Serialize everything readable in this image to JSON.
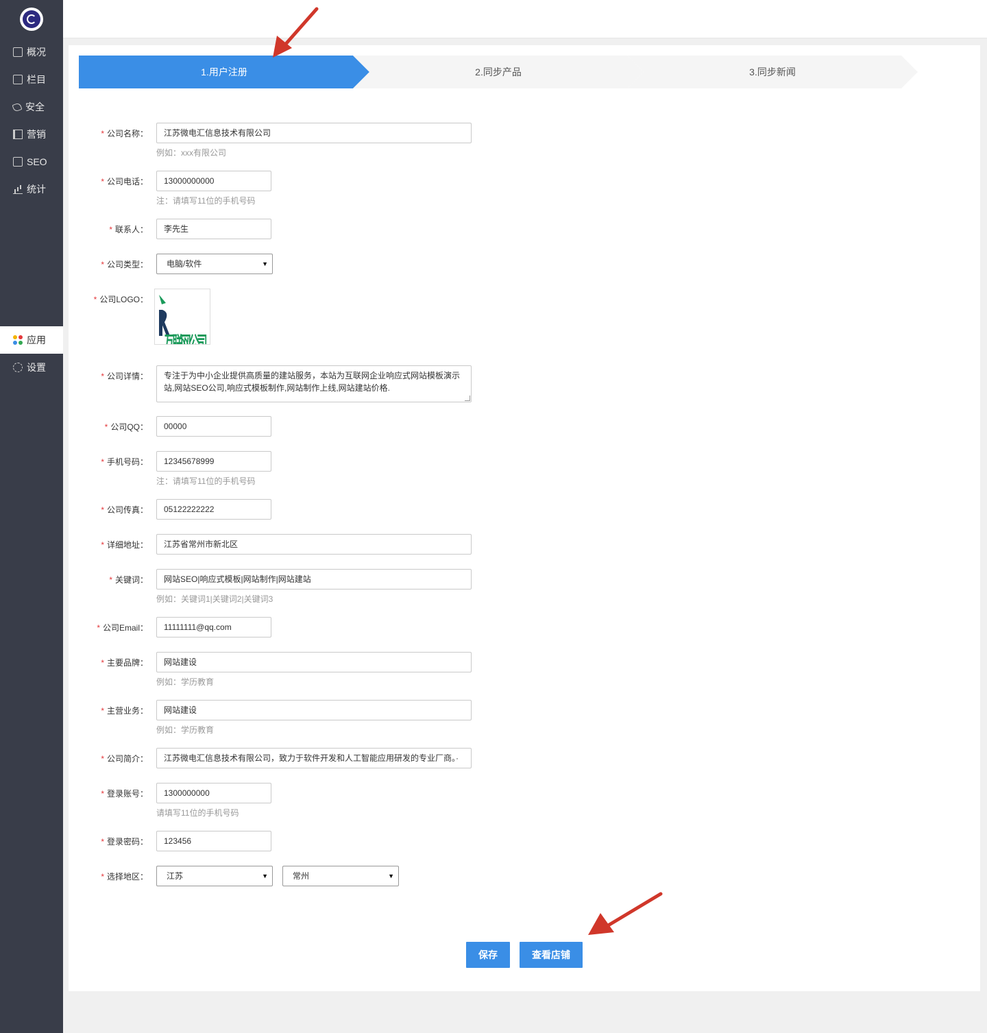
{
  "sidebar": {
    "items": [
      {
        "label": "概况",
        "icon": "monitor-icon"
      },
      {
        "label": "栏目",
        "icon": "list-icon"
      },
      {
        "label": "安全",
        "icon": "tag-icon"
      },
      {
        "label": "营销",
        "icon": "book-icon"
      },
      {
        "label": "SEO",
        "icon": "seo-icon"
      },
      {
        "label": "统计",
        "icon": "bar-chart-icon"
      },
      {
        "label": "应用",
        "icon": "apps-icon",
        "active": true
      },
      {
        "label": "设置",
        "icon": "gear-icon"
      }
    ]
  },
  "steps": [
    {
      "label": "1.用户注册",
      "active": true
    },
    {
      "label": "2.同步产品"
    },
    {
      "label": "3.同步新闻"
    }
  ],
  "form": {
    "company_name": {
      "label": "公司名称：",
      "value": "江苏微电汇信息技术有限公司",
      "hint": "例如：xxx有限公司"
    },
    "company_phone": {
      "label": "公司电话：",
      "value": "13000000000",
      "hint": "注：请填写11位的手机号码"
    },
    "contact": {
      "label": "联系人：",
      "value": "李先生"
    },
    "company_type": {
      "label": "公司类型：",
      "value": "电脑/软件"
    },
    "company_logo": {
      "label": "公司LOGO：",
      "logo_text": "互联网公司"
    },
    "company_detail": {
      "label": "公司详情：",
      "value": "专注于为中小企业提供高质量的建站服务，本站为互联网企业响应式网站模板演示站,网站SEO公司,响应式模板制作,网站制作上线,网站建站价格."
    },
    "company_qq": {
      "label": "公司QQ：",
      "value": "00000"
    },
    "mobile": {
      "label": "手机号码：",
      "value": "12345678999",
      "hint": "注：请填写11位的手机号码"
    },
    "fax": {
      "label": "公司传真：",
      "value": "05122222222"
    },
    "address": {
      "label": "详细地址：",
      "value": "江苏省常州市新北区"
    },
    "keywords": {
      "label": "关键词：",
      "value": "网站SEO|响应式模板|网站制作|网站建站",
      "hint": "例如：关键词1|关键词2|关键词3"
    },
    "email": {
      "label": "公司Email：",
      "value": "11111111@qq.com"
    },
    "brand": {
      "label": "主要品牌：",
      "value": "网站建设",
      "hint": "例如：学历教育"
    },
    "business": {
      "label": "主营业务：",
      "value": "网站建设",
      "hint": "例如：学历教育"
    },
    "intro": {
      "label": "公司简介：",
      "value": "江苏微电汇信息技术有限公司，致力于软件开发和人工智能应用研发的专业厂商。·"
    },
    "account": {
      "label": "登录账号：",
      "value": "1300000000",
      "hint": "请填写11位的手机号码"
    },
    "password": {
      "label": "登录密码：",
      "value": "123456"
    },
    "region": {
      "label": "选择地区：",
      "province": "江苏",
      "city": "常州"
    }
  },
  "required_mark": "*",
  "buttons": {
    "save": "保存",
    "view_shop": "查看店铺"
  },
  "colors": {
    "primary": "#3a8ee6",
    "sidebar": "#393d49",
    "required": "#e4393c",
    "annotation": "#d0372a"
  }
}
